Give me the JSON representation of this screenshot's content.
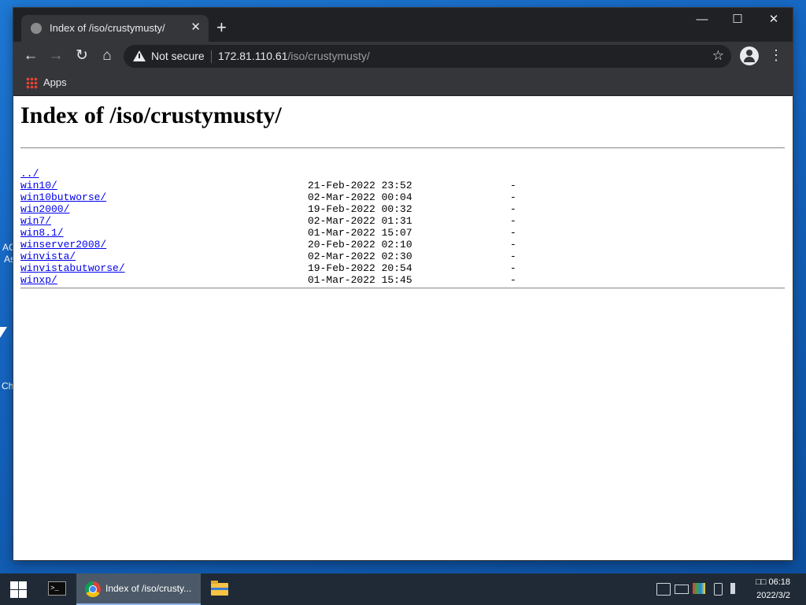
{
  "browser": {
    "tab_title": "Index of /iso/crustymusty/",
    "tab_close": "✕",
    "new_tab": "+",
    "security_label": "Not secure",
    "url_host": "172.81.110.61",
    "url_path": "/iso/crustymusty/",
    "bookmarks": {
      "apps_label": "Apps"
    },
    "window_controls": {
      "minimize": "—",
      "maximize": "☐",
      "close": "✕"
    },
    "icons": {
      "back": "←",
      "forward": "→",
      "reload": "↻",
      "home": "⌂",
      "star": "☆",
      "menu": "⋮"
    }
  },
  "page": {
    "heading": "Index of /iso/crustymusty/",
    "parent_link": "../",
    "entries": [
      {
        "name": "win10/",
        "date": "21-Feb-2022 23:52",
        "size": "-"
      },
      {
        "name": "win10butworse/",
        "date": "02-Mar-2022 00:04",
        "size": "-"
      },
      {
        "name": "win2000/",
        "date": "19-Feb-2022 00:32",
        "size": "-"
      },
      {
        "name": "win7/",
        "date": "02-Mar-2022 01:31",
        "size": "-"
      },
      {
        "name": "win8.1/",
        "date": "01-Mar-2022 15:07",
        "size": "-"
      },
      {
        "name": "winserver2008/",
        "date": "20-Feb-2022 02:10",
        "size": "-"
      },
      {
        "name": "winvista/",
        "date": "02-Mar-2022 02:30",
        "size": "-"
      },
      {
        "name": "winvistabutworse/",
        "date": "19-Feb-2022 20:54",
        "size": "-"
      },
      {
        "name": "winxp/",
        "date": "01-Mar-2022 15:45",
        "size": "-"
      }
    ]
  },
  "desktop": {
    "fragments": [
      "AC",
      "As",
      "Ch"
    ]
  },
  "taskbar": {
    "chrome_label": "Index of /iso/crusty...",
    "console_label": ">_",
    "clock_time": "□□ 06:18",
    "clock_date": "2022/3/2"
  },
  "colors": {
    "link": "#0000ee",
    "chrome_frame": "#202124",
    "chrome_toolbar": "#35363a",
    "taskbar": "#1f2a36"
  }
}
